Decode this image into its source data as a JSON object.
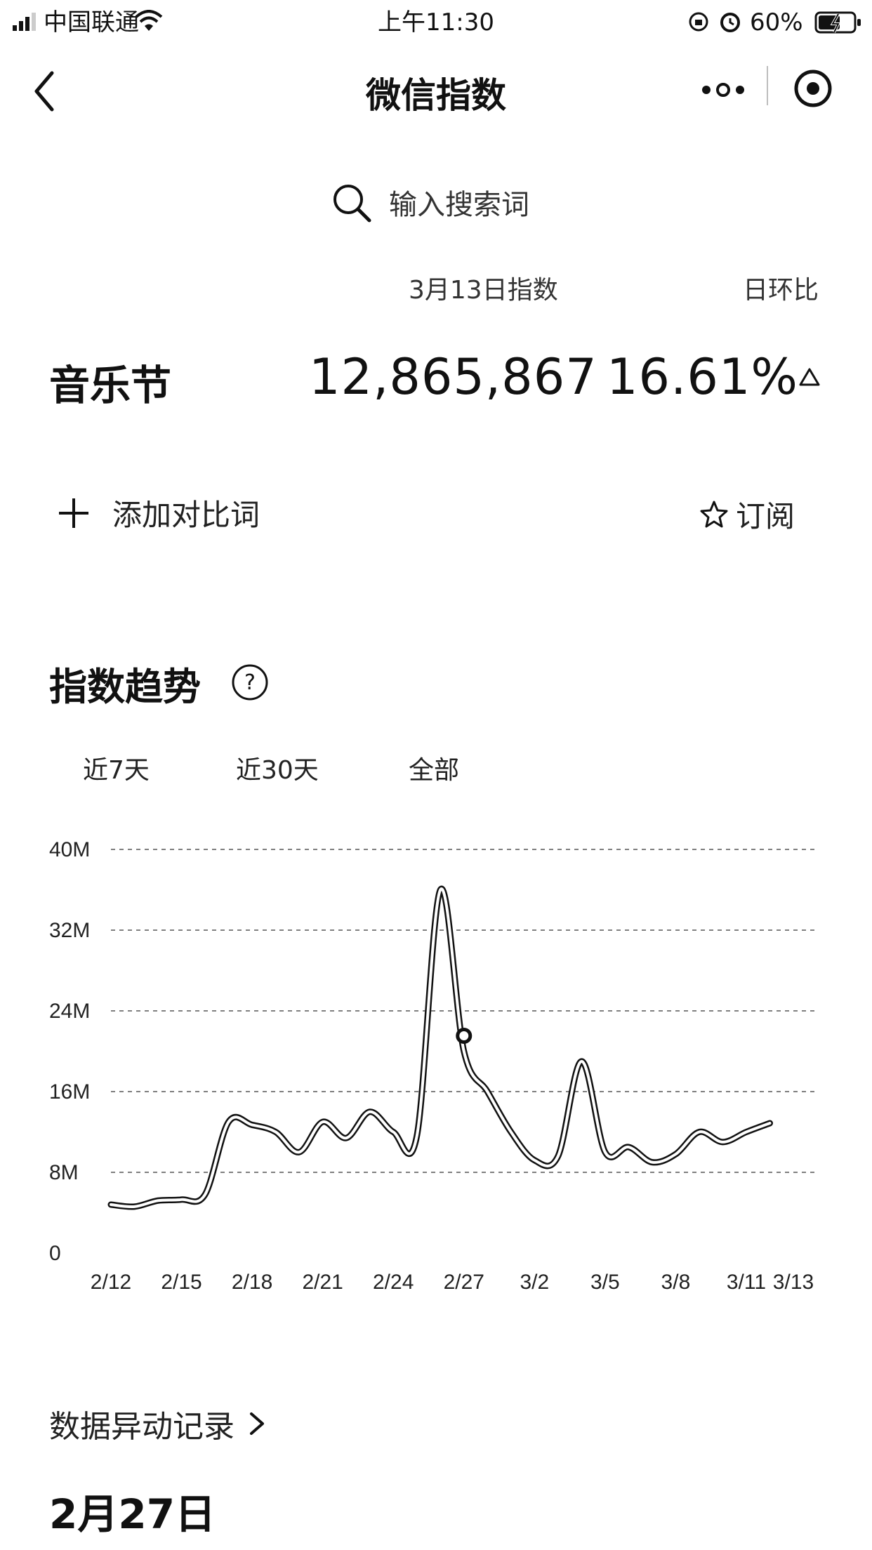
{
  "status_bar": {
    "carrier": "中国联通",
    "time": "上午11:30",
    "battery": "60%"
  },
  "nav": {
    "title": "微信指数"
  },
  "search": {
    "placeholder": "输入搜索词"
  },
  "summary": {
    "date_label": "3月13日指数",
    "ratio_label": "日环比",
    "keyword": "音乐节",
    "index_value": "12,865,867",
    "ratio_value": "16.61%"
  },
  "actions": {
    "add_compare": "添加对比词",
    "subscribe": "订阅"
  },
  "trend": {
    "title": "指数趋势",
    "tabs": [
      "近7天",
      "近30天",
      "全部"
    ]
  },
  "chart_data": {
    "type": "line",
    "x": [
      "2/12",
      "2/13",
      "2/14",
      "2/15",
      "2/16",
      "2/17",
      "2/18",
      "2/19",
      "2/20",
      "2/21",
      "2/22",
      "2/23",
      "2/24",
      "2/25",
      "2/26",
      "2/27",
      "2/28",
      "3/1",
      "3/2",
      "3/3",
      "3/4",
      "3/5",
      "3/6",
      "3/7",
      "3/8",
      "3/9",
      "3/10",
      "3/11",
      "3/12",
      "3/13"
    ],
    "values": [
      4.8,
      4.6,
      5.2,
      5.3,
      5.8,
      13.0,
      12.7,
      12.0,
      10.0,
      13.0,
      11.4,
      14.0,
      12.0,
      11.6,
      36.0,
      20.0,
      16.0,
      12.0,
      9.2,
      9.6,
      19.0,
      10.0,
      10.5,
      9.0,
      9.8,
      12.0,
      11.0,
      12.0,
      12.87
    ],
    "x_tick_labels": [
      "2/12",
      "2/15",
      "2/18",
      "2/21",
      "2/24",
      "2/27",
      "3/2",
      "3/5",
      "3/8",
      "3/11",
      "3/13"
    ],
    "y_tick_labels": [
      "0",
      "8M",
      "16M",
      "24M",
      "32M",
      "40M"
    ],
    "ylim": [
      0,
      40
    ],
    "grid": true,
    "highlight": "2/27",
    "color": "#111111"
  },
  "anomaly": {
    "link_text": "数据异动记录",
    "date": "2月27日"
  }
}
